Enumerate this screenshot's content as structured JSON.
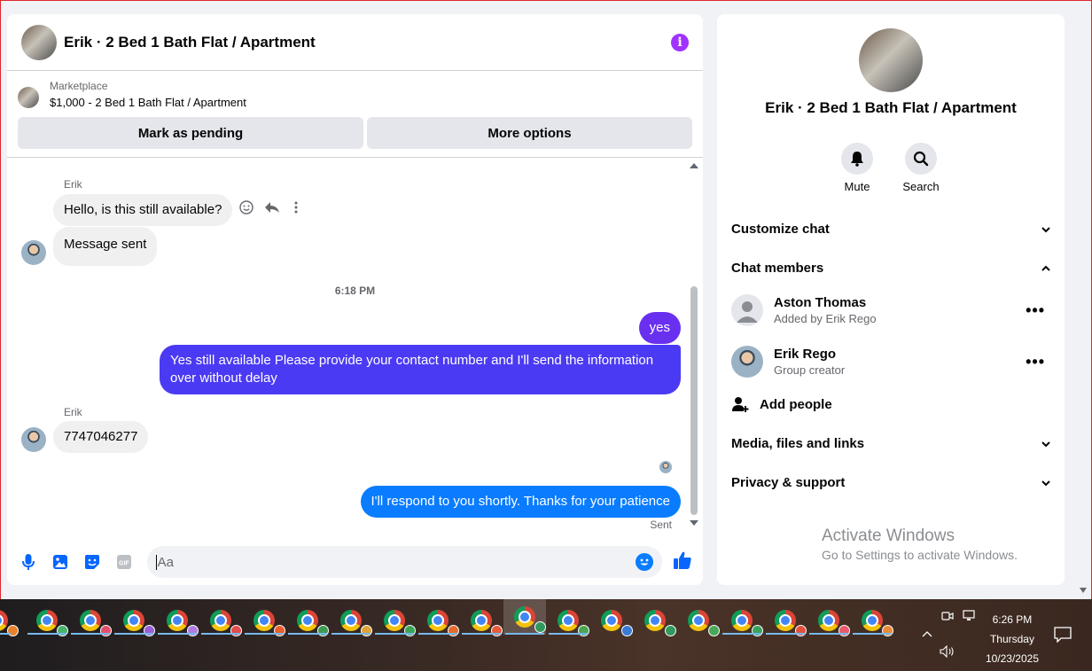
{
  "chat": {
    "title": "Erik · 2 Bed 1 Bath Flat / Apartment",
    "marketplace_label": "Marketplace",
    "listing": "$1,000 - 2 Bed 1 Bath Flat / Apartment",
    "btn_pending": "Mark as pending",
    "btn_more": "More options",
    "sender_erik_1": "Erik",
    "msg_1": "Hello, is this still available?",
    "msg_2": "Message sent",
    "time_sep": "6:18 PM",
    "msg_3": "yes",
    "msg_4": "Yes still available Please provide your contact number and I'll send the information over without delay",
    "sender_erik_2": "Erik",
    "msg_5": "7747046277",
    "msg_6": "I'll respond to you shortly. Thanks for your patience",
    "sent_status": "Sent",
    "input_placeholder": "Aa"
  },
  "info": {
    "title": "Erik · 2 Bed 1 Bath Flat / Apartment",
    "mute": "Mute",
    "search": "Search",
    "customize": "Customize chat",
    "members_header": "Chat members",
    "member_1_name": "Aston Thomas",
    "member_1_sub": "Added by Erik Rego",
    "member_2_name": "Erik Rego",
    "member_2_sub": "Group creator",
    "add_people": "Add people",
    "media": "Media, files and links",
    "privacy": "Privacy & support",
    "watermark_1": "Activate Windows",
    "watermark_2": "Go to Settings to activate Windows."
  },
  "taskbar": {
    "time": "6:26 PM",
    "day": "Thursday",
    "date": "10/23/2025"
  },
  "colors": {
    "accent_purple": "#a033ff",
    "bubble_blue": "#0a7cff",
    "bubble_indigo": "#4b3af3"
  }
}
